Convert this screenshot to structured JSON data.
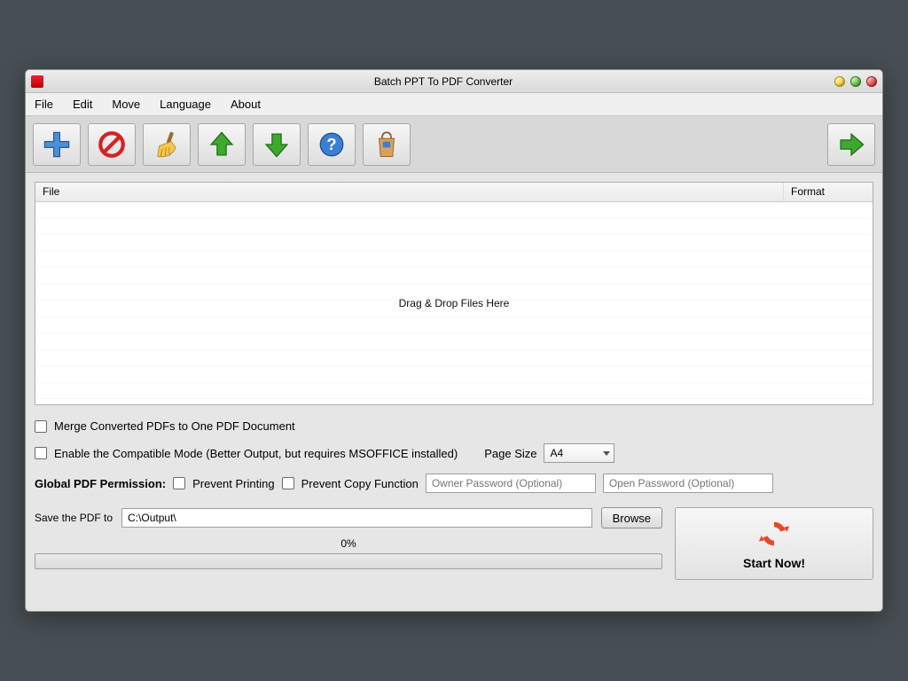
{
  "title": "Batch PPT To PDF Converter",
  "menus": {
    "file": "File",
    "edit": "Edit",
    "move": "Move",
    "language": "Language",
    "about": "About"
  },
  "toolbar": {
    "add": "add",
    "remove": "remove",
    "clear": "clear",
    "up": "up",
    "down": "down",
    "help": "help",
    "buy": "buy",
    "go": "go"
  },
  "list": {
    "col_file": "File",
    "col_format": "Format",
    "drop_text": "Drag & Drop Files Here"
  },
  "opt": {
    "merge": "Merge Converted PDFs to One PDF Document",
    "compat": "Enable the Compatible Mode (Better Output, but requires MSOFFICE installed)",
    "page_size_label": "Page Size",
    "page_size_value": "A4",
    "perm_label": "Global PDF Permission:",
    "prevent_print": "Prevent Printing",
    "prevent_copy": "Prevent Copy Function",
    "owner_pw_ph": "Owner Password (Optional)",
    "open_pw_ph": "Open Password (Optional)"
  },
  "save": {
    "label": "Save the PDF to",
    "path": "C:\\Output\\",
    "browse": "Browse"
  },
  "progress": {
    "label": "0%"
  },
  "start": {
    "label": "Start Now!"
  }
}
